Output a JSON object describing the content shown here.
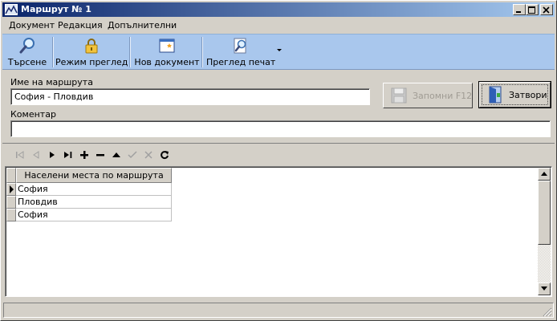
{
  "window": {
    "title": "Маршрут № 1"
  },
  "menu": {
    "items": [
      "Документ",
      "Редакция",
      "Допълнителни"
    ]
  },
  "toolbar": {
    "search_label": "Търсене",
    "view_mode_label": "Режим преглед",
    "new_document_label": "Нов документ",
    "print_preview_label": "Преглед печат"
  },
  "form": {
    "route_name_label": "Име на маршрута",
    "route_name_value": "София - Пловдив",
    "comment_label": "Коментар",
    "comment_value": "",
    "save_button_label": "Запомни  F12",
    "close_button_label": "Затвори"
  },
  "grid": {
    "column_header": "Населени места по маршрута",
    "rows": [
      "София",
      "Пловдив",
      "София"
    ],
    "current_row": 0
  },
  "colors": {
    "title_gradient_start": "#0a246a",
    "title_gradient_end": "#a6caf0",
    "toolbar_background": "#a9c7ed",
    "window_face": "#d4d0c8"
  }
}
